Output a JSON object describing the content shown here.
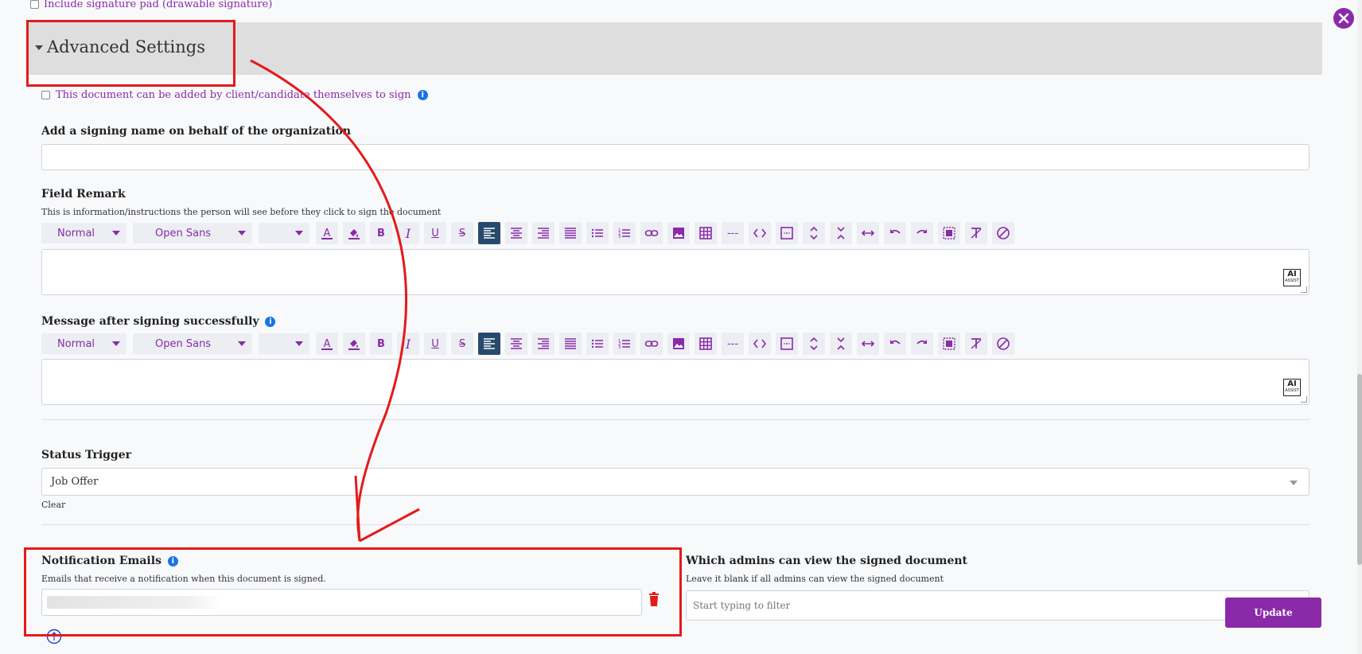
{
  "signature_pad_option": {
    "label": "Include signature pad (drawable signature)",
    "checked": false
  },
  "advanced_settings": {
    "title": "Advanced Settings"
  },
  "client_add_option": {
    "label": "This document can be added by client/candidate themselves to sign",
    "checked": false
  },
  "signing_name": {
    "label": "Add a signing name on behalf of the organization",
    "value": "",
    "placeholder": ""
  },
  "field_remark": {
    "label": "Field Remark",
    "help": "This is information/instructions the person will see before they click to sign the document",
    "toolbar": {
      "format": "Normal",
      "font": "Open Sans",
      "size": ""
    },
    "ai_label": "AI",
    "ai_sub": "ASSIST"
  },
  "message_after": {
    "label": "Message after signing successfully",
    "toolbar": {
      "format": "Normal",
      "font": "Open Sans",
      "size": ""
    },
    "ai_label": "AI",
    "ai_sub": "ASSIST"
  },
  "status_trigger": {
    "label": "Status Trigger",
    "value": "Job Offer",
    "clear_label": "Clear"
  },
  "notification_emails": {
    "label": "Notification Emails",
    "help": "Emails that receive a notification when this document is signed."
  },
  "admins_view": {
    "label": "Which admins can view the signed document",
    "help": "Leave it blank if all admins can view the signed document",
    "placeholder": "Start typing to filter"
  },
  "update_button": {
    "label": "Update"
  },
  "colors": {
    "accent": "#8a2aa8",
    "annotation": "#e31b1b",
    "active_tool": "#27496d",
    "delete": "#e31b1b"
  },
  "icons": [
    "text-color-icon",
    "highlight-color-icon",
    "bold-icon",
    "italic-icon",
    "underline-icon",
    "strikethrough-icon",
    "align-left-icon",
    "align-center-icon",
    "align-right-icon",
    "align-justify-icon",
    "bullet-list-icon",
    "numbered-list-icon",
    "link-icon",
    "image-icon",
    "table-icon",
    "horizontal-rule-icon",
    "code-icon",
    "box-icon",
    "expand-vertical-icon",
    "collapse-vertical-icon",
    "expand-horizontal-icon",
    "undo-icon",
    "redo-icon",
    "select-all-icon",
    "clear-format-icon",
    "block-icon"
  ]
}
